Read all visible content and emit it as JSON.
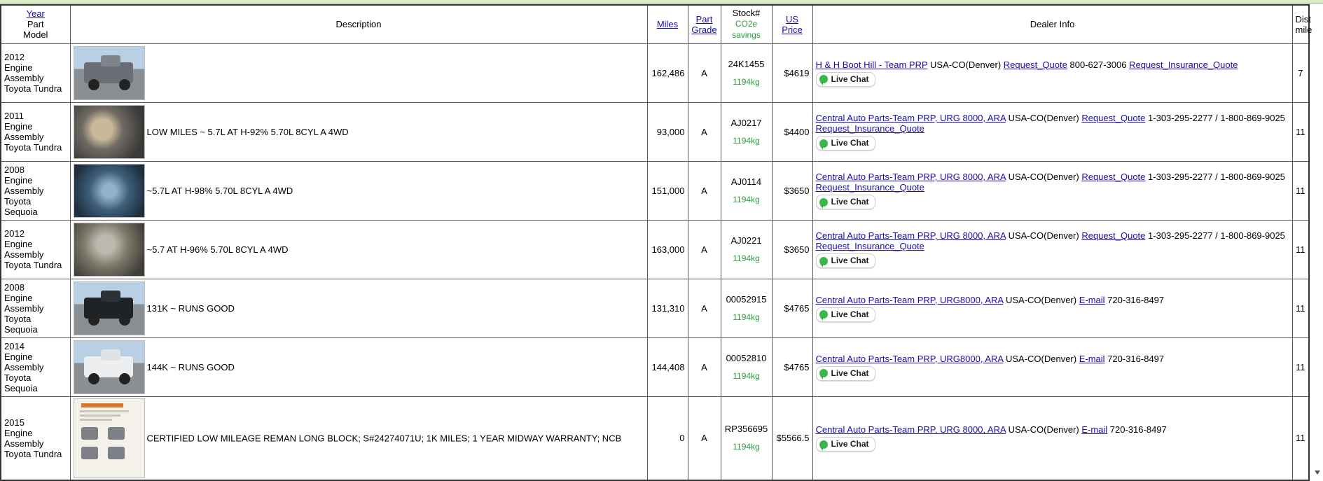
{
  "headers": {
    "year": "Year",
    "part": "Part",
    "model": "Model",
    "description": "Description",
    "miles": "Miles",
    "part_grade_1": "Part",
    "part_grade_2": "Grade",
    "stock": "Stock#",
    "co2_1": "CO2e",
    "co2_2": "savings",
    "us": "US",
    "price": "Price",
    "dealer": "Dealer Info",
    "dist_1": "Dist",
    "dist_2": "mile"
  },
  "chat_label": "Live Chat",
  "colors": {
    "link": "#1a0dab",
    "co2": "#2e9c3f",
    "chat_icon": "#3bb54a",
    "top_bar": "#d5ecc6"
  },
  "rows": [
    {
      "year": "2012",
      "part": "Engine Assembly",
      "model": "Toyota Tundra",
      "thumb": "truck-photo",
      "description": "",
      "miles": "162,486",
      "grade": "A",
      "stock": "24K1455",
      "co2": "1194kg",
      "price": "$4619",
      "dealer_name": "H & H Boot Hill - Team PRP",
      "location": "USA-CO(Denver)",
      "contact1": "Request_Quote",
      "phone": "800-627-3006",
      "contact2": "Request_Insurance_Quote",
      "dist": "7"
    },
    {
      "year": "2011",
      "part": "Engine Assembly",
      "model": "Toyota Tundra",
      "thumb": "engine-photo",
      "description": "LOW MILES ~ 5.7L AT H-92% 5.70L 8CYL A 4WD",
      "miles": "93,000",
      "grade": "A",
      "stock": "AJ0217",
      "co2": "1194kg",
      "price": "$4400",
      "dealer_name": "Central Auto Parts-Team PRP, URG 8000, ARA",
      "location": "USA-CO(Denver)",
      "contact1": "Request_Quote",
      "phone": "1-303-295-2277 / 1-800-869-9025",
      "contact2": "Request_Insurance_Quote",
      "dist": "11"
    },
    {
      "year": "2008",
      "part": "Engine Assembly",
      "model": "Toyota Sequoia",
      "thumb": "engine-photo",
      "description": "~5.7L AT H-98% 5.70L 8CYL A 4WD",
      "miles": "151,000",
      "grade": "A",
      "stock": "AJ0114",
      "co2": "1194kg",
      "price": "$3650",
      "dealer_name": "Central Auto Parts-Team PRP, URG 8000, ARA",
      "location": "USA-CO(Denver)",
      "contact1": "Request_Quote",
      "phone": "1-303-295-2277 / 1-800-869-9025",
      "contact2": "Request_Insurance_Quote",
      "dist": "11"
    },
    {
      "year": "2012",
      "part": "Engine Assembly",
      "model": "Toyota Tundra",
      "thumb": "engine-photo",
      "description": "~5.7 AT H-96% 5.70L 8CYL A 4WD",
      "miles": "163,000",
      "grade": "A",
      "stock": "AJ0221",
      "co2": "1194kg",
      "price": "$3650",
      "dealer_name": "Central Auto Parts-Team PRP, URG 8000, ARA",
      "location": "USA-CO(Denver)",
      "contact1": "Request_Quote",
      "phone": "1-303-295-2277 / 1-800-869-9025",
      "contact2": "Request_Insurance_Quote",
      "dist": "11"
    },
    {
      "year": "2008",
      "part": "Engine Assembly",
      "model": "Toyota Sequoia",
      "thumb": "suv-photo",
      "description": "131K ~ RUNS GOOD",
      "miles": "131,310",
      "grade": "A",
      "stock": "00052915",
      "co2": "1194kg",
      "price": "$4765",
      "dealer_name": "Central Auto Parts-Team PRP, URG8000, ARA",
      "location": "USA-CO(Denver)",
      "contact1": "E-mail",
      "phone": "720-316-8497",
      "contact2": "",
      "dist": "11"
    },
    {
      "year": "2014",
      "part": "Engine Assembly",
      "model": "Toyota Sequoia",
      "thumb": "suv-photo",
      "description": "144K ~ RUNS GOOD",
      "miles": "144,408",
      "grade": "A",
      "stock": "00052810",
      "co2": "1194kg",
      "price": "$4765",
      "dealer_name": "Central Auto Parts-Team PRP, URG8000, ARA",
      "location": "USA-CO(Denver)",
      "contact1": "E-mail",
      "phone": "720-316-8497",
      "contact2": "",
      "dist": "11"
    },
    {
      "year": "2015",
      "part": "Engine Assembly",
      "model": "Toyota Tundra",
      "thumb": "document-photo",
      "description": "CERTIFIED LOW MILEAGE REMAN LONG BLOCK; S#24274071U; 1K MILES; 1 YEAR MIDWAY WARRANTY; NCB",
      "miles": "0",
      "grade": "A",
      "stock": "RP356695",
      "co2": "1194kg",
      "price": "$5566.5",
      "dealer_name": "Central Auto Parts-Team PRP, URG 8000, ARA",
      "location": "USA-CO(Denver)",
      "contact1": "E-mail",
      "phone": "720-316-8497",
      "contact2": "",
      "dist": "11"
    }
  ]
}
